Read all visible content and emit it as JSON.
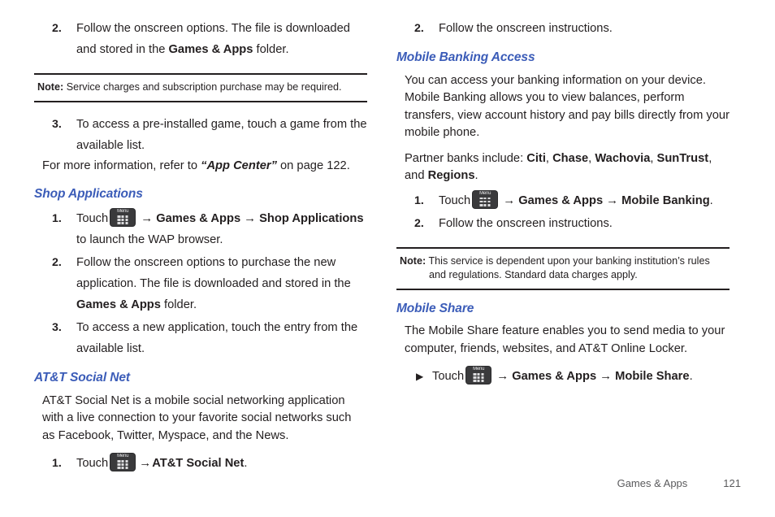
{
  "document": {
    "footer": {
      "section": "Games & Apps",
      "page_number": "121"
    },
    "accent_color": "#3b5cb8",
    "text_color": "#231f20"
  },
  "left_column": {
    "app_center_step2": {
      "number": "2.",
      "text_before": "Follow the onscreen options. The file is downloaded and stored in the ",
      "bold": "Games & Apps",
      "text_after": " folder."
    },
    "note_service_charges": {
      "label": "Note:",
      "text": "Service charges and subscription purchase may be required."
    },
    "app_center_step3": {
      "number": "3.",
      "text": "To access a pre-installed game, touch a game from the available list."
    },
    "cross_reference": {
      "text_before": "For more information, refer to ",
      "reference": "“App Center”",
      "text_after": " on page 122."
    },
    "shop_applications": {
      "heading": "Shop Applications",
      "step1": {
        "number": "1.",
        "touch_label": "Touch",
        "menu_icon_label": "Menu",
        "arrow": "→",
        "item1": "Games & Apps",
        "item2": "Shop Applications",
        "text_after": " to launch the WAP browser."
      },
      "step2": {
        "number": "2.",
        "text_before": "Follow the onscreen options to purchase the new application. The file is downloaded and stored in the ",
        "bold": "Games & Apps",
        "text_after": " folder."
      },
      "step3": {
        "number": "3.",
        "text": "To access a new application, touch the entry from the available list."
      }
    },
    "att_social_net": {
      "heading": "AT&T Social Net",
      "description": "AT&T Social Net is a mobile social networking application with a live connection to your favorite social networks such as Facebook, Twitter, Myspace, and the News.",
      "step1": {
        "number": "1.",
        "touch_label": "Touch",
        "menu_icon_label": "Menu",
        "arrow": "→",
        "item1": "AT&T Social Net",
        "text_after": "."
      }
    }
  },
  "right_column": {
    "top_step2": {
      "number": "2.",
      "text": "Follow the onscreen instructions."
    },
    "mobile_banking_access": {
      "heading": "Mobile Banking Access",
      "description": "You can access your banking information on your device. Mobile Banking allows you to view balances, perform transfers, view account history and pay bills directly from your mobile phone.",
      "partner_banks_intro": "Partner banks include: ",
      "banks": [
        "Citi",
        "Chase",
        "Wachovia",
        "SunTrust",
        "Regions"
      ],
      "partner_banks_conjunction": ", and ",
      "partner_banks_end": ".",
      "step1": {
        "number": "1.",
        "touch_label": "Touch",
        "menu_icon_label": "Menu",
        "arrow": "→",
        "item1": "Games & Apps",
        "item2": "Mobile Banking",
        "text_after": "."
      },
      "step2": {
        "number": "2.",
        "text": "Follow the onscreen instructions."
      },
      "note": {
        "label": "Note:",
        "text": "This service is dependent upon your banking institution’s rules and regulations. Standard data charges apply."
      }
    },
    "mobile_share": {
      "heading": "Mobile Share",
      "description": "The Mobile Share feature enables you to send media to your computer, friends, websites, and AT&T Online Locker.",
      "step": {
        "bullet": "▶",
        "touch_label": "Touch",
        "menu_icon_label": "Menu",
        "arrow": "→",
        "item1": "Games & Apps",
        "item2": "Mobile Share",
        "text_after": "."
      }
    }
  }
}
